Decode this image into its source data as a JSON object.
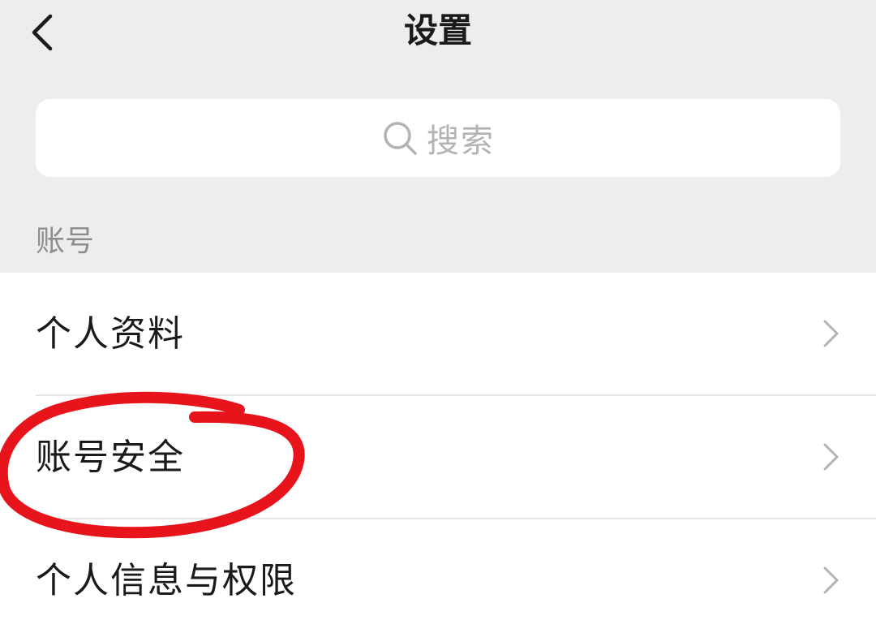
{
  "header": {
    "title": "设置",
    "back_icon": "chevron-left-icon"
  },
  "search": {
    "placeholder": "搜索",
    "icon": "search-icon"
  },
  "section": {
    "title": "账号"
  },
  "list": {
    "items": [
      {
        "label": "个人资料",
        "icon": "chevron-right-icon"
      },
      {
        "label": "账号安全",
        "icon": "chevron-right-icon"
      },
      {
        "label": "个人信息与权限",
        "icon": "chevron-right-icon"
      }
    ]
  },
  "colors": {
    "background": "#ededed",
    "card": "#ffffff",
    "text": "#1a1a1a",
    "muted": "#8c8c8c",
    "placeholder": "#b3b3b3",
    "annotation": "#e8141c"
  }
}
